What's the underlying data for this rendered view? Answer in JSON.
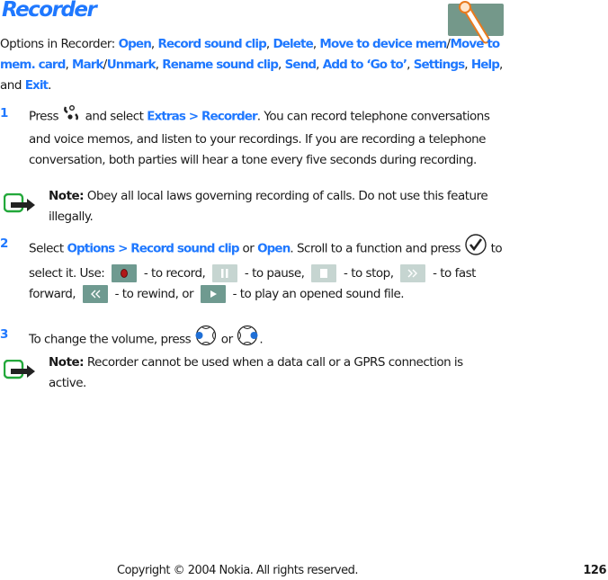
{
  "title": "Recorder",
  "intro": {
    "prefix": "Options in Recorder: ",
    "options": [
      "Open",
      "Record sound clip",
      "Delete",
      "Move to device mem",
      "Move to mem. card",
      "Mark",
      "Unmark",
      "Rename sound clip",
      "Send",
      "Add to ‘Go to’",
      "Settings",
      "Help",
      "Exit"
    ],
    "sep_comma": ", ",
    "sep_slash": "/",
    "and": ", and ",
    "end": "."
  },
  "steps": [
    {
      "number": "1",
      "text_a": "Press ",
      "text_b": " and select ",
      "link": "Extras > Recorder",
      "text_c": ". You can record telephone conversations and voice memos, and listen to your recordings. If you are recording a telephone conversation, both parties will hear a tone every five seconds during recording."
    },
    {
      "number": "2",
      "text_a": "Select ",
      "link_a": "Options > Record sound clip",
      "text_or": " or ",
      "link_b": "Open",
      "text_b": ". Scroll to a function and press ",
      "text_c": " to select it. Use: ",
      "record": " - to record, ",
      "pause": " - to pause, ",
      "stop": " - to stop, ",
      "ffwd": " - to fast forward, ",
      "rewind": " - to rewind, or ",
      "play": " - to play an opened sound file."
    },
    {
      "number": "3",
      "text_a": "To change the volume, press ",
      "text_or": " or ",
      "text_end": "."
    }
  ],
  "notes": [
    {
      "label": "Note:",
      "text": "  Obey all local laws governing recording of calls. Do not use this feature illegally."
    },
    {
      "label": "Note:",
      "text": " Recorder cannot be used when a data call or a GPRS connection is active."
    }
  ],
  "footer": {
    "copyright": "Copyright © 2004 Nokia. All rights reserved.",
    "page": "126"
  },
  "colors": {
    "accent": "#1f78ff",
    "button_dark": "#6f9a90",
    "button_light": "#c6d5d1",
    "note_green": "#22a83a"
  }
}
